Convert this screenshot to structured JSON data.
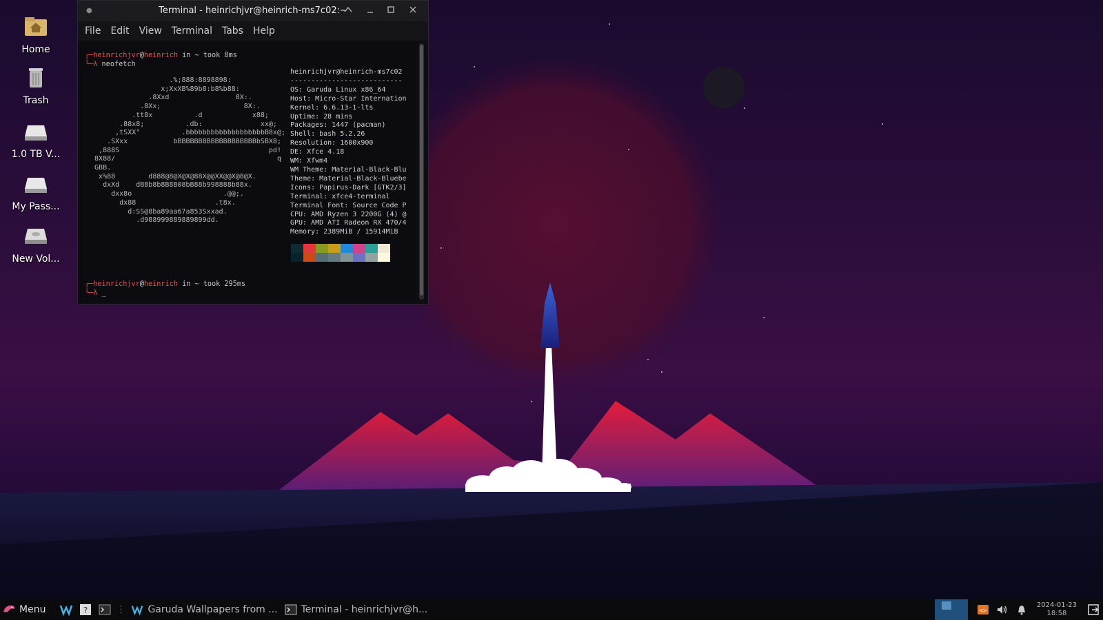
{
  "desktop": {
    "icons": [
      {
        "label": "Home",
        "icon": "home-folder-icon"
      },
      {
        "label": "Trash",
        "icon": "trash-icon"
      },
      {
        "label": "1.0 TB V...",
        "icon": "drive-icon"
      },
      {
        "label": "My Pass...",
        "icon": "drive-icon"
      },
      {
        "label": "New Vol...",
        "icon": "drive-icon"
      }
    ]
  },
  "terminal": {
    "title": "Terminal - heinrichjvr@heinrich-ms7c02:~",
    "menu": [
      "File",
      "Edit",
      "View",
      "Terminal",
      "Tabs",
      "Help"
    ],
    "prompt1": {
      "user": "heinrichjvr",
      "at": "@",
      "host": "heinrich",
      "rest": " in ~ took 8ms",
      "cmd": "neofetch"
    },
    "prompt2": {
      "user": "heinrichjvr",
      "at": "@",
      "host": "heinrich",
      "rest": " in ~ took 295ms",
      "cmd": "_"
    },
    "ascii_art": "                    .%;888:8898898:\n                  x;XxXB%89b8:b8%b88:\n               .8Xxd                8X:.\n             .8Xx;                    8X:.\n           .tt8x          .d            x88;\n        .88x8;          .db:              xx@;\n       ,tSXX°          .bbbbbbbbbbbbbbbbbbbB8x@;\n     .SXxx           bBBBBBBBBBBBBBBBBBBBbSBX8;\n   ,888S                                    pd!\n  8X88/                                       q\n  GBB.\n   x%88        d888@8@X@X@88X@@XX@@X@8@X.\n    dxXd    dB8b8b8B8B08bB88b998888b88x.\n      dxx8o                      .@@;.\n        dx88                   .t8x.\n          d:SS@8ba89aa67a853Sxxad.\n            .d988999889889899dd.",
    "info_lines": [
      "heinrichjvr@heinrich-ms7c02",
      "---------------------------",
      "OS: Garuda Linux x86_64",
      "Host: Micro-Star Internation",
      "Kernel: 6.6.13-1-lts",
      "Uptime: 28 mins",
      "Packages: 1447 (pacman)",
      "Shell: bash 5.2.26",
      "Resolution: 1600x900",
      "DE: Xfce 4.18",
      "WM: Xfwm4",
      "WM Theme: Material-Black-Blu",
      "Theme: Material-Black-Bluebe",
      "Icons: Papirus-Dark [GTK2/3]",
      "Terminal: xfce4-terminal",
      "Terminal Font: Source Code P",
      "CPU: AMD Ryzen 3 2200G (4) @",
      "GPU: AMD ATI Radeon RX 470/4",
      "Memory: 2389MiB / 15914MiB"
    ],
    "swatch_colors": [
      "#0e2a32",
      "#e0383b",
      "#8b9a1f",
      "#c99b17",
      "#2389d6",
      "#d3438c",
      "#2aa198",
      "#eee8d5",
      "#08232c",
      "#cb4b16",
      "#586e75",
      "#657b83",
      "#839496",
      "#6c71c4",
      "#93a1a1",
      "#fdf6e3"
    ]
  },
  "taskbar": {
    "menu_label": "Menu",
    "tasks": [
      {
        "label": "Garuda Wallpapers from ...",
        "icon": "garuda-wallpaper-icon"
      },
      {
        "label": "Terminal - heinrichjvr@h...",
        "icon": "terminal-icon"
      }
    ],
    "clock": {
      "date": "2024-01-23",
      "time": "18:58"
    }
  }
}
